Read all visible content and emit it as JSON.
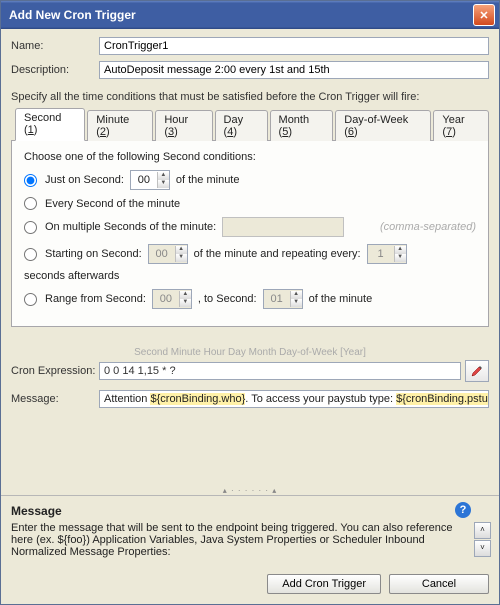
{
  "title": "Add New Cron Trigger",
  "labels": {
    "name": "Name:",
    "description": "Description:",
    "instr": "Specify all the time conditions that must be satisfied before the Cron Trigger will fire:",
    "choose": "Choose one of the following Second conditions:",
    "cronExpr": "Cron Expression:",
    "message": "Message:",
    "hintHeader": "Second  Minute  Hour  Day  Month  Day-of-Week  [Year]",
    "commaSep": "(comma-separated)"
  },
  "fields": {
    "name": "CronTrigger1",
    "description": "AutoDeposit message 2:00 every 1st and 15th",
    "cronExpr": "0 0 14 1,15 * ?"
  },
  "tabs": [
    {
      "label": "Second",
      "key": "1",
      "active": true
    },
    {
      "label": "Minute",
      "key": "2",
      "active": false
    },
    {
      "label": "Hour",
      "key": "3",
      "active": false
    },
    {
      "label": "Day",
      "key": "4",
      "active": false
    },
    {
      "label": "Month",
      "key": "5",
      "active": false
    },
    {
      "label": "Day-of-Week",
      "key": "6",
      "active": false
    },
    {
      "label": "Year",
      "key": "7",
      "active": false
    }
  ],
  "options": {
    "just": {
      "label_a": "Just on Second:",
      "label_b": "of the minute",
      "value": "00",
      "selected": true
    },
    "every": {
      "label": "Every Second of the minute"
    },
    "multiple": {
      "label": "On multiple  Seconds of the minute:"
    },
    "starting": {
      "label_a": "Starting on Second:",
      "label_b": "of the minute and repeating every:",
      "label_c": "seconds afterwards",
      "v1": "00",
      "v2": "1"
    },
    "range": {
      "label_a": "Range from Second:",
      "label_b": ", to Second:",
      "label_c": "of the minute",
      "v1": "00",
      "v2": "01"
    }
  },
  "message": {
    "p1": "Attention ",
    "h1": "${cronBinding.who}",
    "p2": ". To access your paystub type: ",
    "h2": "${cronBinding.pstub}",
    "p3": "."
  },
  "help": {
    "title": "Message",
    "body": "Enter the message that will be sent to the endpoint being triggered.  You can also reference here (ex. ${foo}) Application Variables, Java System Properties or Scheduler Inbound Normalized Message Properties:"
  },
  "buttons": {
    "ok": "Add Cron Trigger",
    "cancel": "Cancel"
  }
}
